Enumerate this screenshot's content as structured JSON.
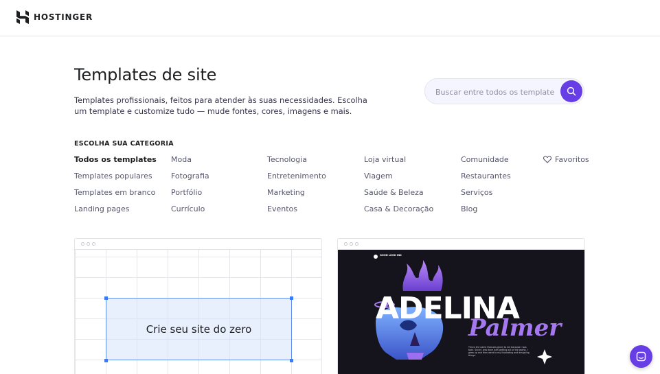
{
  "brand": {
    "name": "HOSTINGER"
  },
  "hero": {
    "title": "Templates de site",
    "description": "Templates profissionais, feitos para atender às suas necessidades. Escolha um template e customize tudo — mude fontes, cores, imagens e mais."
  },
  "search": {
    "placeholder": "Buscar entre todos os template"
  },
  "categories": {
    "heading": "ESCOLHA SUA CATEGORIA",
    "col1": [
      "Todos os templates",
      "Templates populares",
      "Templates em branco",
      "Landing pages"
    ],
    "col2": [
      "Moda",
      "Fotografia",
      "Portfólio",
      "Currículo"
    ],
    "col3": [
      "Tecnologia",
      "Entretenimento",
      "Marketing",
      "Eventos"
    ],
    "col4": [
      "Loja virtual",
      "Viagem",
      "Saúde & Beleza",
      "Casa & Decoração"
    ],
    "col5": [
      "Comunidade",
      "Restaurantes",
      "Serviços",
      "Blog"
    ],
    "active": "Todos os templates",
    "favorites_label": "Favoritos"
  },
  "cards": {
    "blank": {
      "label": "Crie seu site do zero"
    },
    "template": {
      "logo_text": "GOOD LOOK INK",
      "headline": "ADELINA",
      "subline": "Palmer",
      "body": "This is the name that was given to me because I was born. Since I was done with getting out of the womb, I grew up and then went to my illustrating and designing things."
    }
  },
  "colors": {
    "accent": "#673de6",
    "text": "#1d1e20",
    "muted": "#55566a"
  },
  "icons": {
    "search": "search-icon",
    "chat": "chat-icon",
    "favorites": "heart-icon"
  }
}
